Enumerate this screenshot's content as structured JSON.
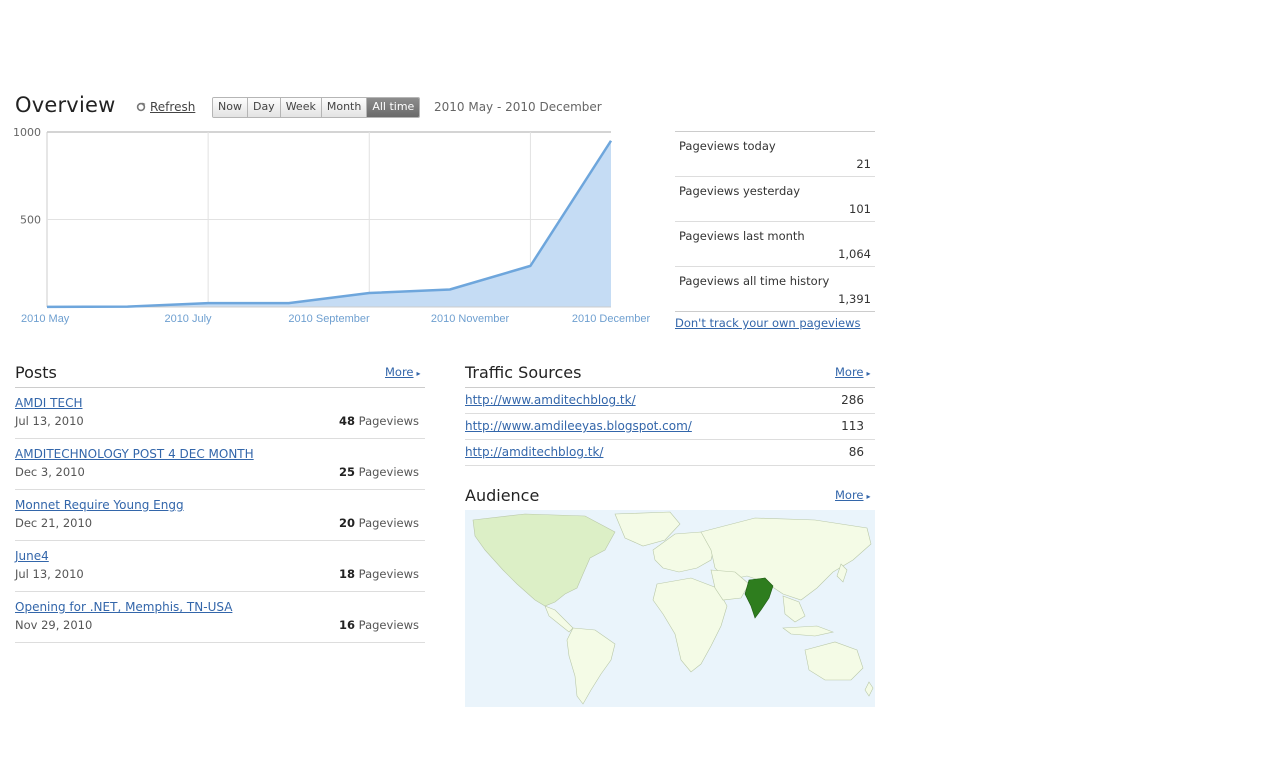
{
  "overview": {
    "title": "Overview",
    "refresh_label": "Refresh",
    "ranges": [
      "Now",
      "Day",
      "Week",
      "Month",
      "All time"
    ],
    "active_range": "All time",
    "date_range": "2010 May - 2010 December"
  },
  "chart_data": {
    "type": "area",
    "x": [
      "2010 May",
      "2010 June",
      "2010 July",
      "2010 August",
      "2010 September",
      "2010 October",
      "2010 November",
      "2010 December"
    ],
    "xtick_labels": [
      "2010 May",
      "2010 July",
      "2010 September",
      "2010 November",
      "2010 December"
    ],
    "values": [
      1,
      2,
      22,
      22,
      80,
      100,
      235,
      950
    ],
    "yticks": [
      "1000",
      "500"
    ],
    "ylim": [
      0,
      1000
    ],
    "grid": true,
    "line_color": "#6ea6dc",
    "fill_color": "#c5dcf4"
  },
  "stats": [
    {
      "label": "Pageviews today",
      "value": "21"
    },
    {
      "label": "Pageviews yesterday",
      "value": "101"
    },
    {
      "label": "Pageviews last month",
      "value": "1,064"
    },
    {
      "label": "Pageviews all time history",
      "value": "1,391"
    }
  ],
  "dont_track": "Don't track your own pageviews",
  "posts": {
    "title": "Posts",
    "more": "More",
    "views_suffix": "Pageviews",
    "items": [
      {
        "title": "AMDI TECH",
        "date": "Jul 13, 2010",
        "views": "48"
      },
      {
        "title": "AMDITECHNOLOGY POST 4 DEC MONTH",
        "date": "Dec 3, 2010",
        "views": "25"
      },
      {
        "title": "Monnet Require Young Engg",
        "date": "Dec 21, 2010",
        "views": "20"
      },
      {
        "title": "June4",
        "date": "Jul 13, 2010",
        "views": "18"
      },
      {
        "title": "Opening for .NET, Memphis, TN-USA",
        "date": "Nov 29, 2010",
        "views": "16"
      }
    ]
  },
  "traffic": {
    "title": "Traffic Sources",
    "more": "More",
    "items": [
      {
        "url": "http://www.amditechblog.tk/",
        "count": "286"
      },
      {
        "url": "http://www.amdileeyas.blogspot.com/",
        "count": "113"
      },
      {
        "url": "http://amditechblog.tk/",
        "count": "86"
      }
    ]
  },
  "audience": {
    "title": "Audience",
    "more": "More",
    "ocean_color": "#eaf4fb",
    "land_color": "#f4fbe6",
    "highlight_color": "#2e7d1e"
  }
}
